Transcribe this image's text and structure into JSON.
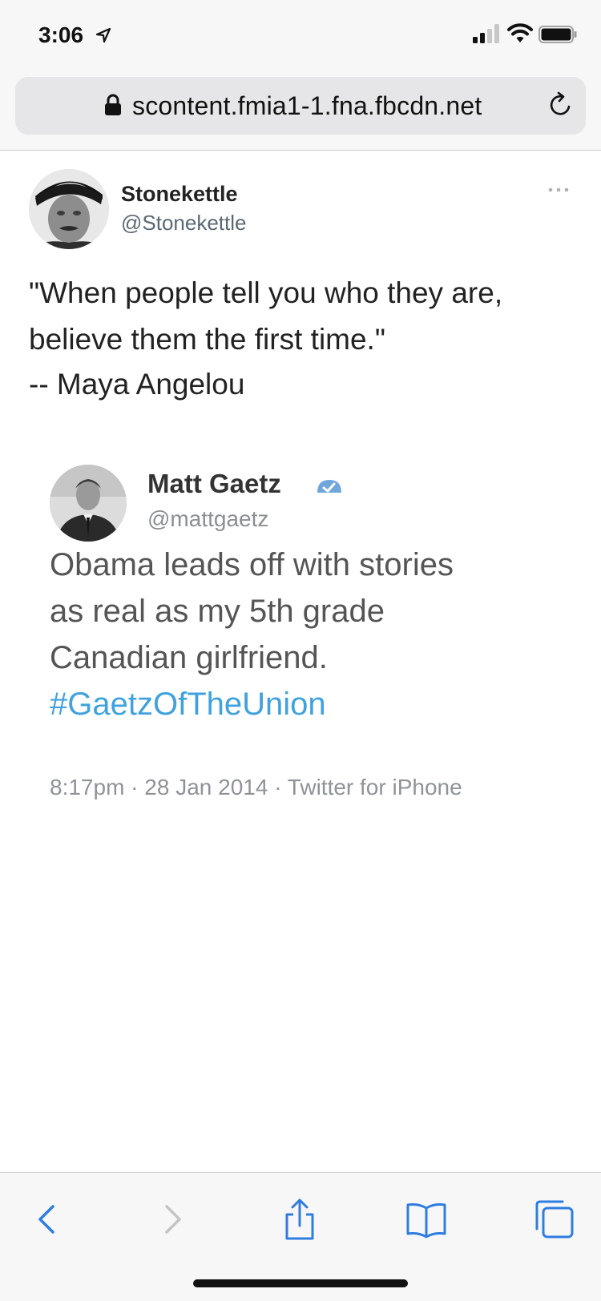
{
  "status_bar": {
    "time": "3:06",
    "icons": [
      "location-arrow-icon",
      "cellular-signal-icon",
      "wifi-icon",
      "battery-icon"
    ]
  },
  "browser": {
    "url": "scontent.fmia1-1.fna.fbcdn.net",
    "icons": [
      "lock-icon",
      "reload-icon"
    ]
  },
  "post": {
    "author": {
      "name": "Stonekettle",
      "handle": "@Stonekettle"
    },
    "quote_lines": [
      "\"When people tell you who they are,",
      "believe them the first time.\"",
      "-- Maya Angelou"
    ],
    "embedded_tweet": {
      "author": {
        "name": "Matt Gaetz",
        "handle": "@mattgaetz"
      },
      "text_lines": [
        "Obama leads off with stories",
        "as real as my 5th grade",
        "Canadian girlfriend."
      ],
      "hashtag": "#GaetzOfTheUnion",
      "meta": "8:17pm · 28 Jan 2014 · Twitter for iPhone"
    }
  },
  "toolbar": {
    "buttons": [
      "back-icon",
      "forward-icon",
      "share-icon",
      "bookmarks-icon",
      "tabs-icon"
    ]
  },
  "colors": {
    "accent_blue": "#2f7de1",
    "hashtag_blue": "#3fa2de",
    "urlbar_bg": "#e6e6e8",
    "chrome_bg": "#f7f7f7"
  }
}
